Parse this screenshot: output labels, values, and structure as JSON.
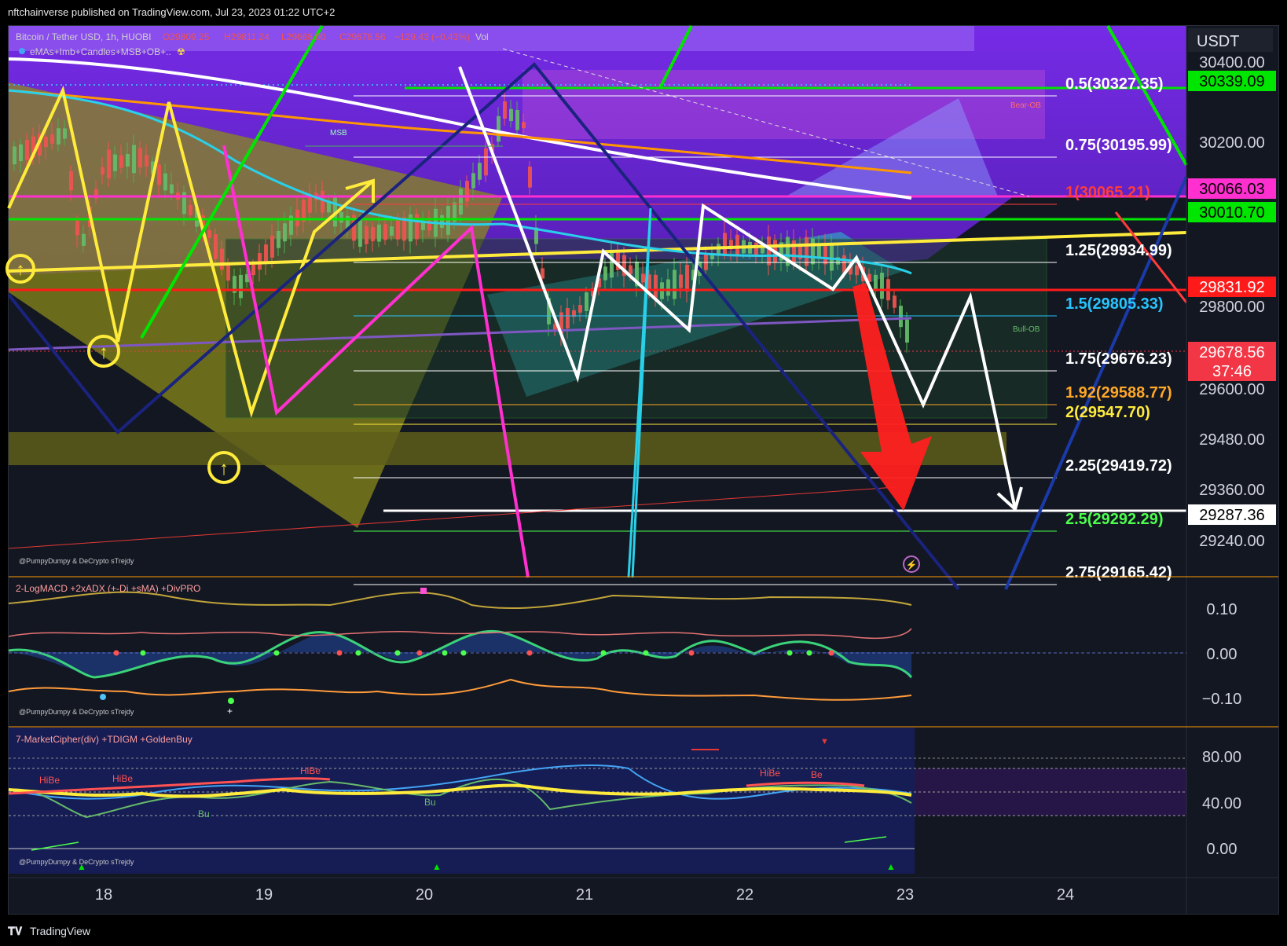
{
  "header": {
    "published": "nftchainverse published on TradingView.com, Jul 23, 2023 01:22 UTC+2"
  },
  "symbol": {
    "name": "Bitcoin / Tether USD, 1h, HUOBI",
    "open": "O29809.25",
    "high": "H29811.24",
    "low": "L29668.00",
    "close": "C29678.56",
    "change": "−129.43 (−0.43%)",
    "vol": "Vol",
    "indicator": "eMAs+Imb+Candles+MSB+OB+.."
  },
  "currency": "USDT",
  "price_axis": {
    "ticks": [
      "30400.00",
      "30200.00",
      "29800.00",
      "29600.00",
      "29480.00",
      "29360.00",
      "29240.00"
    ],
    "labels": [
      {
        "text": "30339.09",
        "color": "#00e600",
        "fg": "#000000"
      },
      {
        "text": "30066.03",
        "color": "#ff2fd0",
        "fg": "#000000"
      },
      {
        "text": "30010.70",
        "color": "#00e600",
        "fg": "#000000"
      },
      {
        "text": "29831.92",
        "color": "#ff1a1a",
        "fg": "#ffffff"
      },
      {
        "text": "29678.56",
        "color": "#f23645",
        "fg": "#ffffff"
      },
      {
        "text": "37:46",
        "color": "#f23645",
        "fg": "#ffffff"
      },
      {
        "text": "29287.36",
        "color": "#ffffff",
        "fg": "#000000"
      }
    ]
  },
  "fib_levels": [
    {
      "text": "0.5(30327.35)",
      "color": "#ffffff"
    },
    {
      "text": "0.75(30195.99)",
      "color": "#ffffff"
    },
    {
      "text": "1(30065.21)",
      "color": "#ff3b3b"
    },
    {
      "text": "1.25(29934.99)",
      "color": "#ffffff"
    },
    {
      "text": "1.5(29805.33)",
      "color": "#26c6ff"
    },
    {
      "text": "1.75(29676.23)",
      "color": "#ffffff"
    },
    {
      "text": "1.92(29588.77)",
      "color": "#ffa726"
    },
    {
      "text": "2(29547.70)",
      "color": "#ffeb3b"
    },
    {
      "text": "2.25(29419.72)",
      "color": "#ffffff"
    },
    {
      "text": "2.5(29292.29)",
      "color": "#4cff4c"
    },
    {
      "text": "2.75(29165.42)",
      "color": "#ffffff"
    }
  ],
  "chart_labels": {
    "bear_ob": "Bear-OB",
    "bull_ob": "Bull-OB",
    "msb": "MSB",
    "credit": "@PumpyDumpy & DeCrypto sTrejdy"
  },
  "macd": {
    "title": "2-LogMACD +2xADX (+-Di +sMA) +DivPRO",
    "ticks": [
      "0.10",
      "0.00",
      "−0.10"
    ],
    "credit": "@PumpyDumpy & DeCrypto sTrejdy"
  },
  "cipher": {
    "title": "7-MarketCipher(div) +TDIGM +GoldenBuy",
    "ticks": [
      "80.00",
      "40.00",
      "0.00"
    ],
    "credit": "@PumpyDumpy & DeCrypto sTrejdy",
    "tags": [
      "HiBe",
      "HiBe",
      "HiBe",
      "HiBe",
      "Be",
      "Bu",
      "Bu"
    ]
  },
  "time_axis": [
    "18",
    "19",
    "20",
    "21",
    "22",
    "23",
    "24"
  ],
  "footer": {
    "brand": "TradingView"
  }
}
